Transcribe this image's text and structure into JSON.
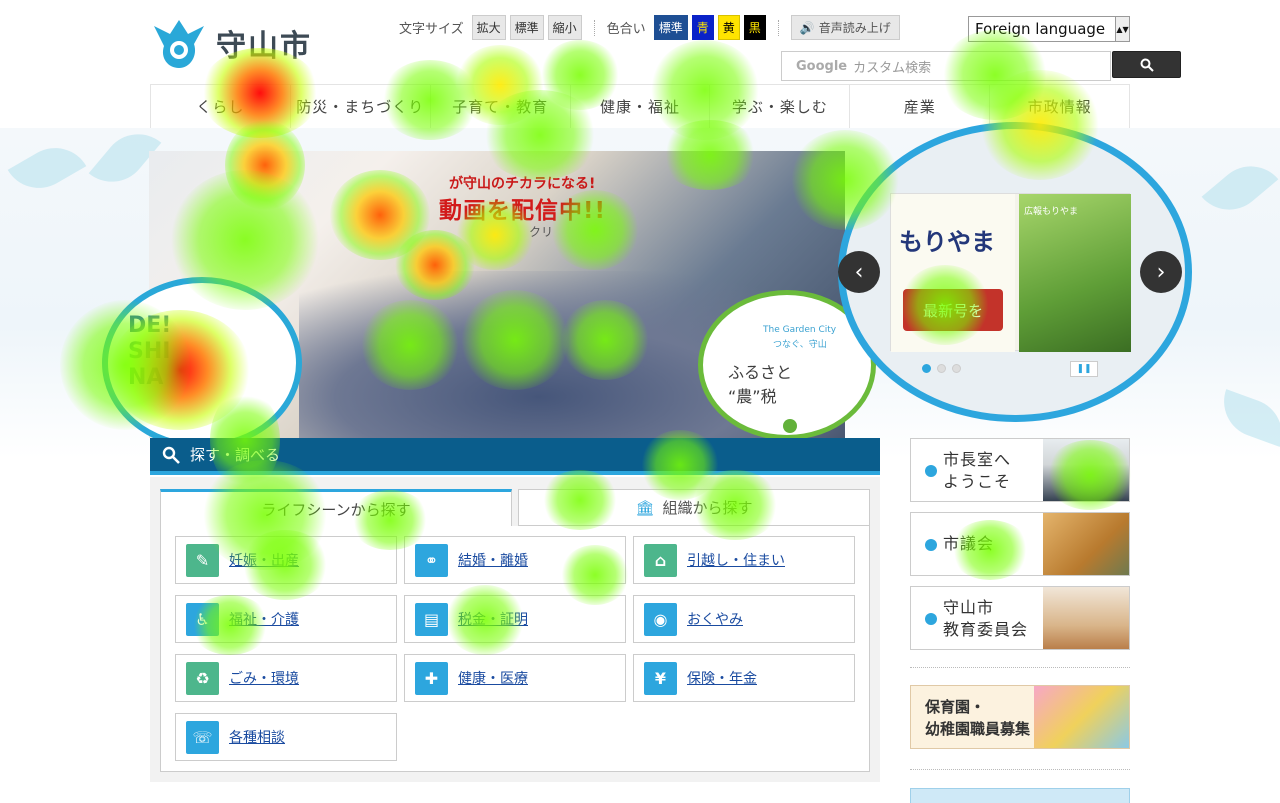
{
  "site": {
    "logo_text": "守山市"
  },
  "utility": {
    "text_size_label": "文字サイズ",
    "text_size_options": [
      "拡大",
      "標準",
      "縮小"
    ],
    "color_label": "色合い",
    "color_options": [
      {
        "label": "標準",
        "bg": "#1e4f94"
      },
      {
        "label": "青",
        "bg": "#0a22c8"
      },
      {
        "label": "黄",
        "bg": "#ffe400"
      },
      {
        "label": "黒",
        "bg": "#000000"
      }
    ],
    "voice_label": "音声読み上げ",
    "language_select": "Foreign language"
  },
  "search": {
    "placeholder": "カスタム検索",
    "brand": "Google"
  },
  "global_nav": [
    "くらし",
    "防災・まちづくり",
    "子育て・教育",
    "健康・福祉",
    "学ぶ・楽しむ",
    "産業",
    "市政情報"
  ],
  "hero": {
    "line1": "が守山のチカラになる!",
    "line2": "動画を配信中!!",
    "line3": "クリ",
    "left_circle_text": [
      "DE!",
      "SHI",
      "NA"
    ],
    "garden": {
      "en": "The Garden City",
      "sub": "つなぐ、守山",
      "title1": "ふるさと",
      "title2": "“農”税"
    }
  },
  "slider": {
    "brand": "もりやま",
    "button": "最新号を",
    "issue": "広報もりやま",
    "dots": 3,
    "active_dot": 1,
    "prev_icon": "‹",
    "next_icon": "›"
  },
  "find": {
    "heading": "探す・調べる",
    "tabs": [
      {
        "label": "ライフシーンから探す",
        "active": true
      },
      {
        "label": "組織から探す",
        "active": false
      }
    ],
    "cards": [
      {
        "label": "妊娠・出産",
        "icon": "baby-icon"
      },
      {
        "label": "結婚・離婚",
        "icon": "couple-icon"
      },
      {
        "label": "引越し・住まい",
        "icon": "house-icon"
      },
      {
        "label": "福祉・介護",
        "icon": "wheelchair-icon"
      },
      {
        "label": "税金・証明",
        "icon": "document-icon"
      },
      {
        "label": "おくやみ",
        "icon": "portrait-icon"
      },
      {
        "label": "ごみ・環境",
        "icon": "garbage-bag-icon"
      },
      {
        "label": "健康・医療",
        "icon": "cross-icon"
      },
      {
        "label": "保険・年金",
        "icon": "money-bag-icon"
      },
      {
        "label": "各種相談",
        "icon": "consultation-icon"
      }
    ]
  },
  "right": {
    "mayor": "市長室へ\nようこそ",
    "council": "市議会",
    "education": "守山市\n教育委員会",
    "recruit": "保育園・\n幼稚園職員募集"
  }
}
